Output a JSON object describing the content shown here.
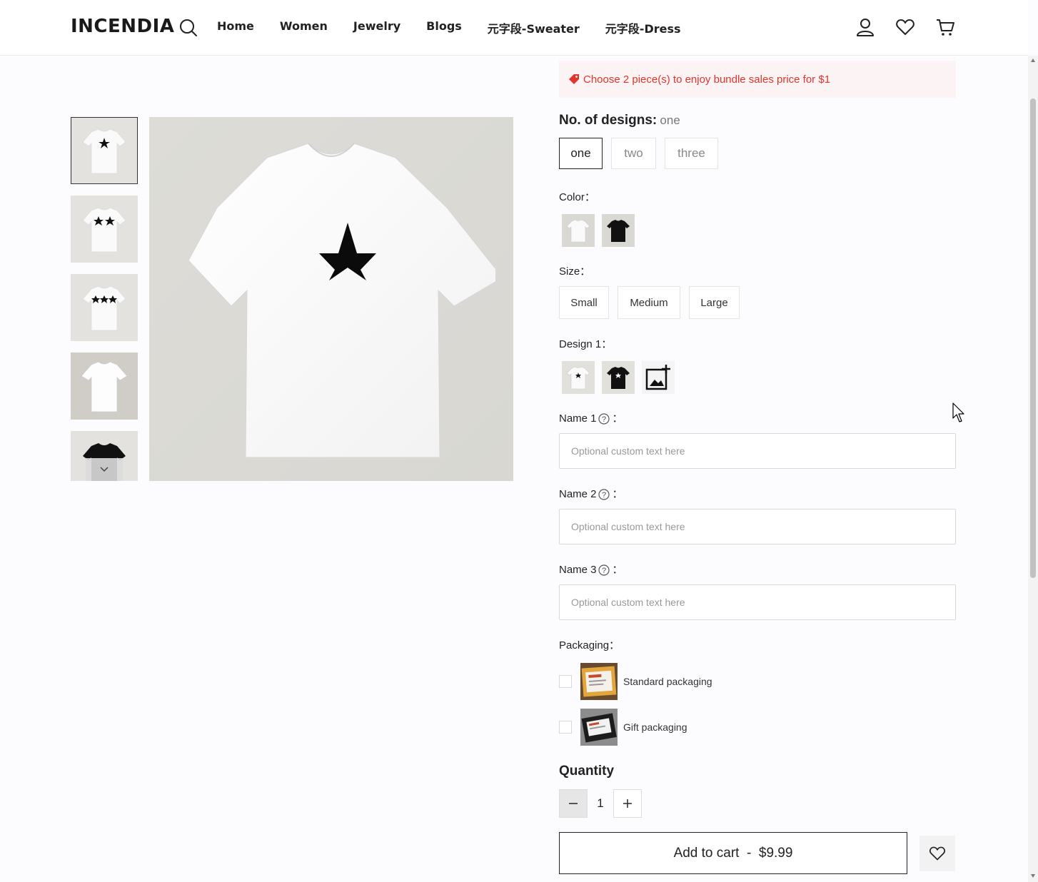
{
  "header": {
    "logo": "INCENDIA",
    "nav": [
      "Home",
      "Women",
      "Jewelry",
      "Blogs",
      "元字段-Sweater",
      "元字段-Dress"
    ],
    "icons": [
      "search-icon",
      "account-icon",
      "heart-icon",
      "cart-icon"
    ]
  },
  "gallery": {
    "thumbnails": [
      "one-star-white-tee",
      "two-star-white-tee",
      "three-star-white-tee",
      "plain-white-tee",
      "black-tee"
    ],
    "main_image": "one-star-white-tee"
  },
  "promo": {
    "text": "Choose 2 piece(s) to enjoy bundle sales price for $1",
    "color": "#e0362c"
  },
  "designs": {
    "label": "No. of designs:",
    "selected": "one",
    "options": [
      "one",
      "two",
      "three"
    ]
  },
  "color": {
    "label": "Color：",
    "options": [
      "white-tee",
      "black-tee"
    ]
  },
  "size": {
    "label": "Size：",
    "options": [
      "Small",
      "Medium",
      "Large"
    ]
  },
  "design1": {
    "label": "Design 1：",
    "options": [
      "white-star-tee",
      "black-star-tee",
      "add-image-icon"
    ]
  },
  "names": [
    {
      "label": "Name 1",
      "colon": "：",
      "placeholder": "Optional custom text here"
    },
    {
      "label": "Name 2",
      "colon": "：",
      "placeholder": "Optional custom text here"
    },
    {
      "label": "Name 3",
      "colon": "：",
      "placeholder": "Optional custom text here"
    }
  ],
  "packaging": {
    "label": "Packaging：",
    "options": [
      "Standard packaging",
      "Gift packaging"
    ]
  },
  "quantity": {
    "label": "Quantity",
    "value": "1",
    "minus": "−",
    "plus": "+"
  },
  "cart": {
    "label": "Add to cart  -  $9.99"
  }
}
